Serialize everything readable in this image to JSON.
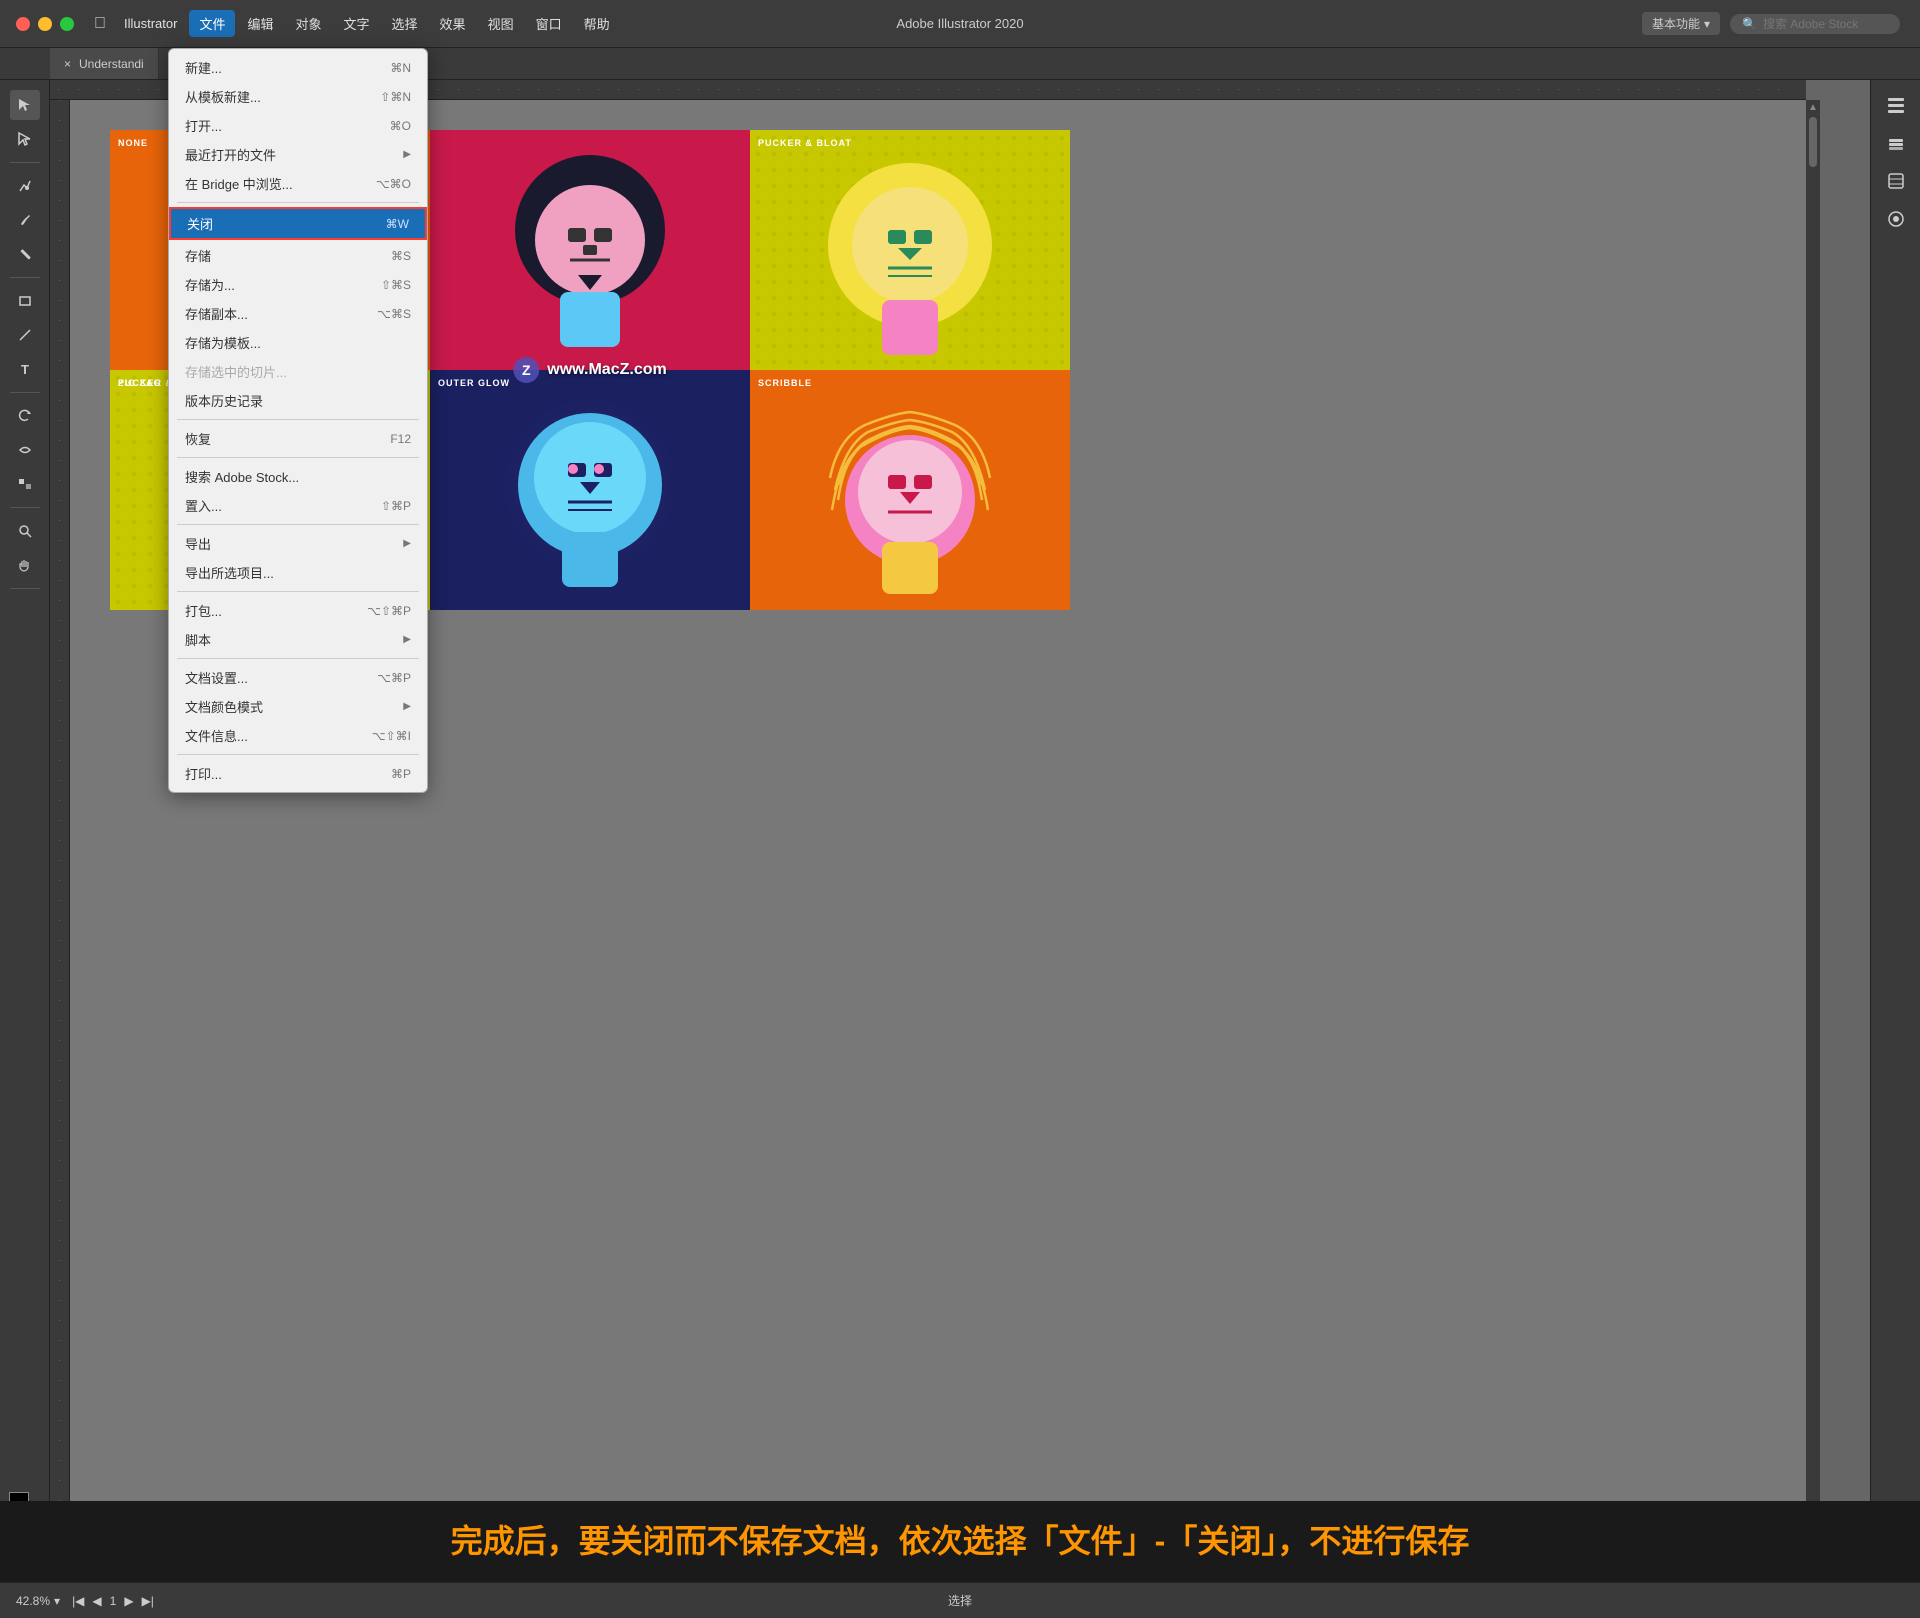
{
  "titleBar": {
    "appName": "Illustrator",
    "title": "Adobe Illustrator 2020",
    "workspaceLabel": "基本功能",
    "searchPlaceholder": "搜索 Adobe Stock"
  },
  "menuBar": {
    "apple": "",
    "items": [
      "Illustrator",
      "文件",
      "编辑",
      "对象",
      "文字",
      "选择",
      "效果",
      "视图",
      "窗口",
      "帮助"
    ]
  },
  "fileMenu": {
    "items": [
      {
        "label": "新建...",
        "shortcut": "⌘N",
        "disabled": false,
        "submenu": false
      },
      {
        "label": "从模板新建...",
        "shortcut": "⇧⌘N",
        "disabled": false,
        "submenu": false
      },
      {
        "label": "打开...",
        "shortcut": "⌘O",
        "disabled": false,
        "submenu": false
      },
      {
        "label": "最近打开的文件",
        "shortcut": "",
        "disabled": false,
        "submenu": true
      },
      {
        "label": "在 Bridge 中浏览...",
        "shortcut": "⌥⌘O",
        "disabled": false,
        "submenu": false
      },
      {
        "separator": true
      },
      {
        "label": "关闭",
        "shortcut": "⌘W",
        "disabled": false,
        "highlighted": true,
        "submenu": false
      },
      {
        "label": "存储",
        "shortcut": "⌘S",
        "disabled": false,
        "submenu": false
      },
      {
        "label": "存储为...",
        "shortcut": "⇧⌘S",
        "disabled": false,
        "submenu": false
      },
      {
        "label": "存储副本...",
        "shortcut": "⌥⌘S",
        "disabled": false,
        "submenu": false
      },
      {
        "label": "存储为模板...",
        "shortcut": "",
        "disabled": false,
        "submenu": false
      },
      {
        "label": "存储选中的切片...",
        "shortcut": "",
        "disabled": true,
        "submenu": false
      },
      {
        "label": "版本历史记录",
        "shortcut": "",
        "disabled": false,
        "submenu": false
      },
      {
        "separator": true
      },
      {
        "label": "恢复",
        "shortcut": "F12",
        "disabled": false,
        "submenu": false
      },
      {
        "separator": true
      },
      {
        "label": "搜索 Adobe Stock...",
        "shortcut": "",
        "disabled": false,
        "submenu": false
      },
      {
        "label": "置入...",
        "shortcut": "⇧⌘P",
        "disabled": false,
        "submenu": false
      },
      {
        "separator": true
      },
      {
        "label": "导出",
        "shortcut": "",
        "disabled": false,
        "submenu": true
      },
      {
        "label": "导出所选项目...",
        "shortcut": "",
        "disabled": false,
        "submenu": false
      },
      {
        "separator": true
      },
      {
        "label": "打包...",
        "shortcut": "⌥⇧⌘P",
        "disabled": false,
        "submenu": false
      },
      {
        "label": "脚本",
        "shortcut": "",
        "disabled": false,
        "submenu": true
      },
      {
        "separator": true
      },
      {
        "label": "文档设置...",
        "shortcut": "⌥⌘P",
        "disabled": false,
        "submenu": false
      },
      {
        "label": "文档颜色模式",
        "shortcut": "",
        "disabled": false,
        "submenu": true
      },
      {
        "label": "文件信息...",
        "shortcut": "⌥⇧⌘I",
        "disabled": false,
        "submenu": false
      },
      {
        "separator": true
      },
      {
        "label": "打印...",
        "shortcut": "⌘P",
        "disabled": false,
        "submenu": false
      }
    ]
  },
  "tab": {
    "label": "Understandi",
    "closeIcon": "×"
  },
  "canvas": {
    "artboard": {
      "cells": [
        {
          "id": 0,
          "label": "NONE",
          "bg": "#e8640a"
        },
        {
          "id": 1,
          "label": "",
          "bg": "#c8194a"
        },
        {
          "id": 2,
          "label": "PUCKER & BLOAT",
          "bg": "#c8c800"
        },
        {
          "id": 3,
          "label": "PUCKER & BLOAT",
          "bg": "#c8c800"
        },
        {
          "id": 4,
          "label": "OUTER GLOW",
          "bg": "#1a2060"
        },
        {
          "id": 5,
          "label": "SCRIBBLE",
          "bg": "#e8640a"
        }
      ],
      "bottomRow": [
        {
          "id": 6,
          "label": "ZIG ZAG",
          "bg": "#c8c800"
        },
        {
          "id": 7,
          "label": "",
          "bg": "#00c8b4"
        },
        {
          "id": 8,
          "label": "",
          "bg": ""
        }
      ]
    }
  },
  "watermark": {
    "icon": "Z",
    "text": "www.MacZ.com"
  },
  "statusBar": {
    "zoom": "42.8%",
    "zoomDropdown": "▾",
    "pageNum": "1",
    "statusLabel": "选择"
  },
  "instruction": {
    "text": "完成后，要关闭而不保存文档，依次选择「文件」-「关闭」，不进行保存"
  },
  "rightPanel": {
    "icons": [
      "⬚",
      "◫",
      "⊞",
      "◎"
    ]
  },
  "tools": {
    "icons": [
      "↖",
      "↔",
      "✏",
      "✒",
      "▭",
      "╱",
      "T",
      "↺",
      "⬚",
      "🔍",
      "⊕"
    ]
  }
}
